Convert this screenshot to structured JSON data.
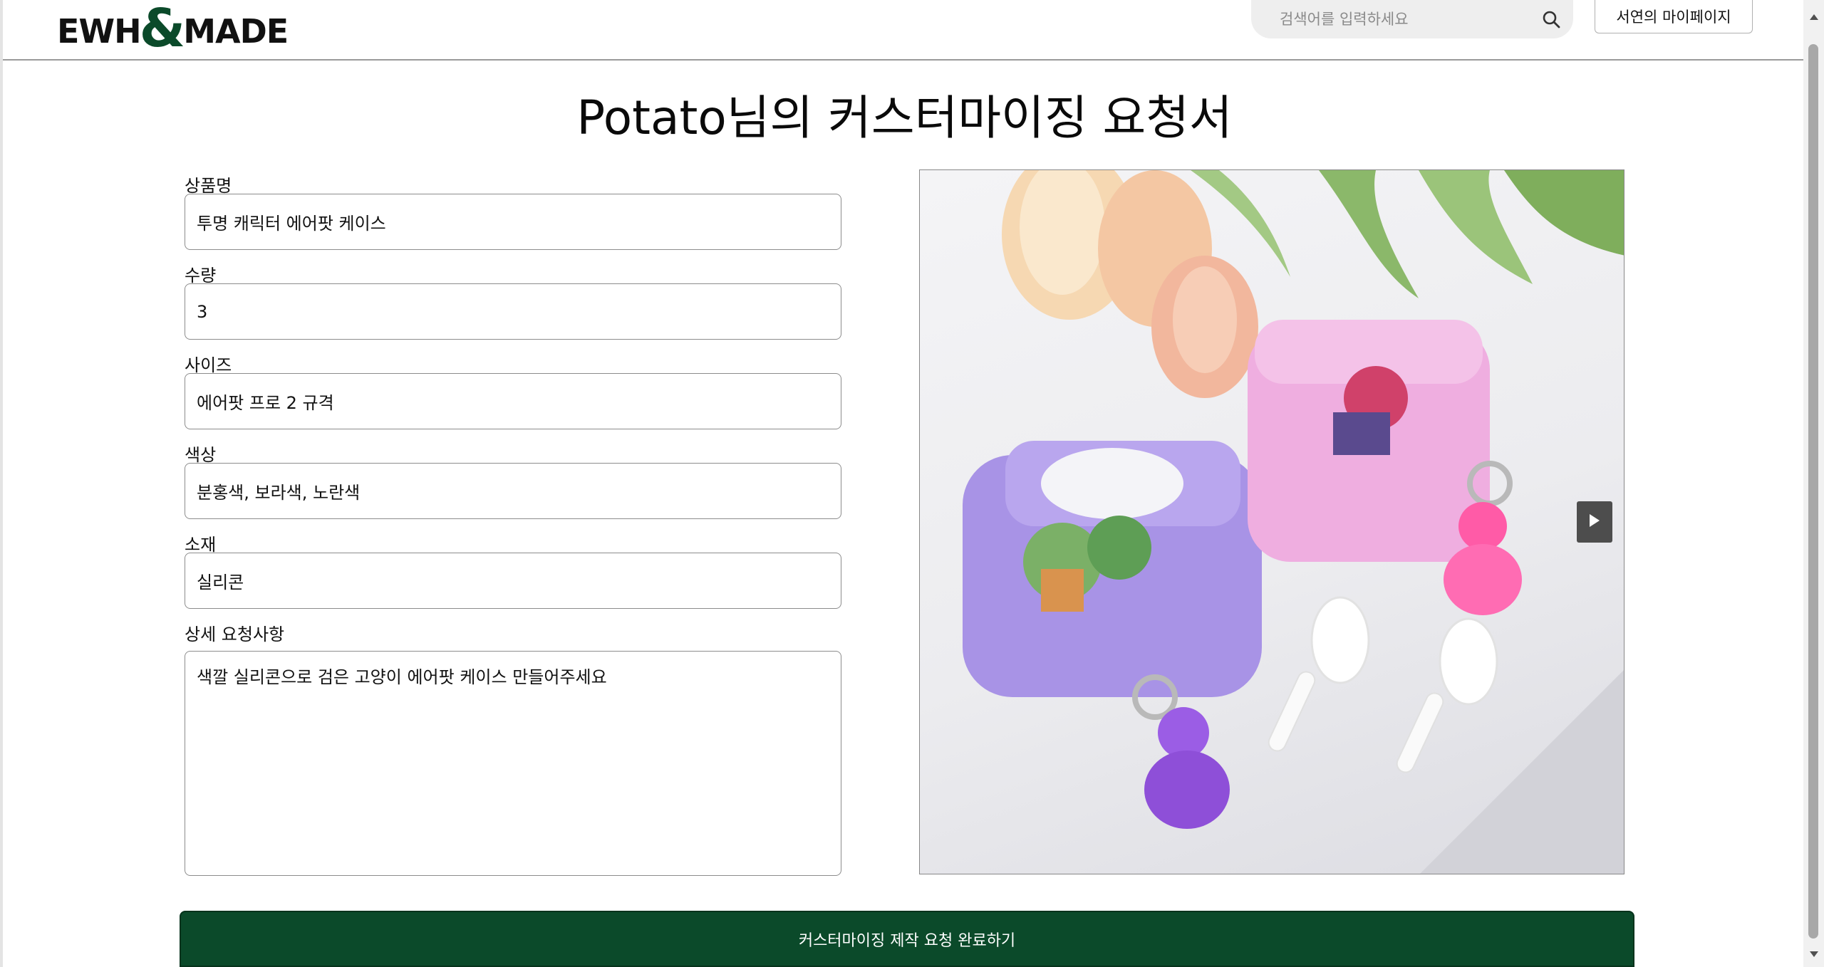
{
  "header": {
    "logo_left": "EWH",
    "logo_amp": "&",
    "logo_right": "MADE",
    "search_placeholder": "검색어를 입력하세요",
    "mypage_label": "서연의 마이페이지"
  },
  "title": "Potato님의 커스터마이징 요청서",
  "form": {
    "product_name": {
      "label": "상품명",
      "value": "투명 캐릭터 에어팟 케이스"
    },
    "quantity": {
      "label": "수량",
      "value": "3"
    },
    "size": {
      "label": "사이즈",
      "value": "에어팟 프로 2 규격"
    },
    "color": {
      "label": "색상",
      "value": "분홍색, 보라색, 노란색"
    },
    "material": {
      "label": "소재",
      "value": "실리콘"
    },
    "details": {
      "label": "상세 요청사항",
      "value": "색깔 실리콘으로 검은 고양이 에어팟 케이스 만들어주세요"
    }
  },
  "submit_label": "커스터마이징 제작 요청 완료하기",
  "colors": {
    "brand_green": "#0b4a2a",
    "search_bg": "#eeeeee"
  },
  "icons": [
    "search-icon",
    "play-next-icon"
  ]
}
